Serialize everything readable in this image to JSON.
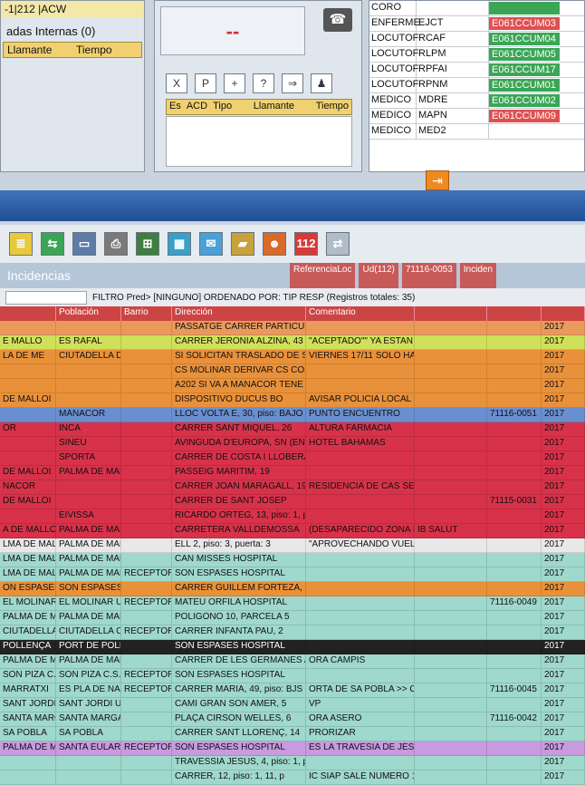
{
  "left_panel": {
    "ext": "-1|212   |ACW",
    "title": "adas Internas (0)",
    "columns": [
      "Llamante",
      "Tiempo"
    ]
  },
  "middle_panel": {
    "display": "--",
    "toolbar": [
      "X",
      "P",
      "+",
      "?",
      "⇒",
      "♟"
    ],
    "columns": [
      "Es",
      "ACD",
      "Tipo",
      "Llamante",
      "Tiempo"
    ]
  },
  "right_panel": {
    "rows": [
      {
        "role": "CORO",
        "code": "",
        "status": "",
        "color": "#3aa655"
      },
      {
        "role": "ENFERME",
        "code": "EJCT",
        "status": "E061CCUM03",
        "color": "#e05050"
      },
      {
        "role": "LOCUTOF",
        "code": "RCAF",
        "status": "E061CCUM04",
        "color": "#3aa655"
      },
      {
        "role": "LOCUTOF",
        "code": "RLPM",
        "status": "E061CCUM05",
        "color": "#3aa655"
      },
      {
        "role": "LOCUTOF",
        "code": "RPFAI",
        "status": "E061CCUM17",
        "color": "#3aa655"
      },
      {
        "role": "LOCUTOF",
        "code": "RPNM",
        "status": "E061CCUM01",
        "color": "#3aa655"
      },
      {
        "role": "MEDICO",
        "code": "MDRE",
        "status": "E061CCUM02",
        "color": "#3aa655"
      },
      {
        "role": "MEDICO",
        "code": "MAPN",
        "status": "E061CCUM09",
        "color": "#e05050"
      },
      {
        "role": "MEDICO",
        "code": "MED2",
        "status": "",
        "color": "#ffffff"
      }
    ]
  },
  "toolbar": {
    "icons": [
      {
        "name": "list-icon",
        "glyph": "≣",
        "bg": "#e7c93a"
      },
      {
        "name": "transfer-icon",
        "glyph": "⇆",
        "bg": "#3aa655"
      },
      {
        "name": "card-icon",
        "glyph": "▭",
        "bg": "#5d7da7"
      },
      {
        "name": "print-icon",
        "glyph": "⎙",
        "bg": "#7a7a7a"
      },
      {
        "name": "windows-icon",
        "glyph": "⊞",
        "bg": "#3e7e3e"
      },
      {
        "name": "gallery-icon",
        "glyph": "▦",
        "bg": "#3aa0c8"
      },
      {
        "name": "mail-icon",
        "glyph": "✉",
        "bg": "#4aa0d8"
      },
      {
        "name": "folder-icon",
        "glyph": "▰",
        "bg": "#c7a23a"
      },
      {
        "name": "people-icon",
        "glyph": "☻",
        "bg": "#d86a2a"
      },
      {
        "name": "emergency-112-icon",
        "glyph": "112",
        "bg": "#d83a3a"
      },
      {
        "name": "dispatch-icon",
        "glyph": "⇄",
        "bg": "#b0bcc8"
      }
    ],
    "exit_glyph": "⇥"
  },
  "grid": {
    "title": "Incidencias",
    "ref_labels": [
      "ReferenciaLoc",
      "Ud(112)",
      "Inciden"
    ],
    "ref_value": "71116-0053",
    "filter_text": "FILTRO Pred> [NINGUNO]  ORDENADO POR: TIP RESP (Registros totales: 35)",
    "headers": [
      "",
      "Población",
      "Barrio",
      "Dirección",
      "Comentario",
      "",
      "",
      ""
    ],
    "rows": [
      {
        "bg": "#e99a5a",
        "cells": [
          "",
          "",
          "",
          "PASSATGE CARRER PARTICULAR",
          "",
          "",
          "",
          "2017"
        ]
      },
      {
        "bg": "#cfe05a",
        "cells": [
          "E MALLO",
          "ES RAFAL",
          "",
          "CARRER JERONIA ALZINA, 43 (CI",
          "\"ACEPTADO\"\" YA ESTAN 1",
          "",
          "",
          "2017"
        ]
      },
      {
        "bg": "#e9913a",
        "cells": [
          "LA DE ME",
          "CIUTADELLA DE ME",
          "",
          "SI SOLICITAN TRASLADO DE SO",
          "VIERNES 17/11 SOLO HABF",
          "",
          "",
          "2017"
        ]
      },
      {
        "bg": "#e9913a",
        "cells": [
          "",
          "",
          "",
          "CS MOLINAR DERIVAR CS COLL",
          "",
          "",
          "",
          "2017"
        ]
      },
      {
        "bg": "#e9913a",
        "cells": [
          "",
          "",
          "",
          "A202 SI VA A MANACOR TENE",
          "",
          "",
          "",
          "2017"
        ]
      },
      {
        "bg": "#e9913a",
        "cells": [
          "DE MALLOI",
          "",
          "",
          "DISPOSITIVO DUCUS BO",
          "AVISAR POLICIA LOCAL SI",
          "",
          "",
          "2017"
        ]
      },
      {
        "bg": "#6a8fd0",
        "cells": [
          "",
          "MANACOR",
          "",
          "LLOC VOLTA E, 30, piso: BAJO",
          "PUNTO ENCUENTRO",
          "",
          "71116-0051",
          "2017"
        ]
      },
      {
        "bg": "#d8324a",
        "cells": [
          "OR",
          "INCA",
          "",
          "CARRER SANT MIQUEL, 26",
          "ALTURA FARMACIA",
          "",
          "",
          "2017"
        ]
      },
      {
        "bg": "#d8324a",
        "cells": [
          "",
          "SINEU",
          "",
          "AVINGUDA D'EUROPA, SN (EN",
          "HOTEL BAHAMAS",
          "",
          "",
          "2017"
        ]
      },
      {
        "bg": "#d8324a",
        "cells": [
          "",
          "SPORTA",
          "",
          "CARRER DE COSTA I LLOBERA",
          "",
          "",
          "",
          "2017"
        ]
      },
      {
        "bg": "#d8324a",
        "cells": [
          "DE MALLOI",
          "PALMA DE MALLOI",
          "",
          "PASSEIG MARITIM, 19",
          "",
          "",
          "",
          "2017"
        ]
      },
      {
        "bg": "#d8324a",
        "cells": [
          "NACOR",
          "",
          "",
          "CARRER JOAN MARAGALL, 19",
          "RESIDENCIA DE CAS SERRE",
          "",
          "",
          "2017"
        ]
      },
      {
        "bg": "#d8324a",
        "cells": [
          "DE MALLOI",
          "",
          "",
          "CARRER DE SANT JOSEP",
          "",
          "",
          "71115-0031",
          "2017"
        ]
      },
      {
        "bg": "#d8324a",
        "cells": [
          "",
          "EIVISSA",
          "",
          "RICARDO ORTEG, 13, piso: 1, pu",
          "",
          "",
          "",
          "2017"
        ]
      },
      {
        "bg": "#d8324a",
        "cells": [
          "A DE MALLOI",
          "PALMA DE MALLOI",
          "",
          "CARRETERA VALLDEMOSSA",
          "(DESAPARECIDO ZONA BU",
          "IB SALUT",
          "",
          "2017"
        ]
      },
      {
        "bg": "#e8e8e8",
        "cells": [
          "LMA DE MALLOI",
          "PALMA DE MALLOI",
          "",
          "ELL 2, piso: 3, puerta: 3",
          "\"APROVECHANDO VUELO\"",
          "",
          "",
          "2017"
        ]
      },
      {
        "bg": "#9fd8cc",
        "cells": [
          "LMA DE MALLOI",
          "PALMA DE MALLOI",
          "",
          "CAN MISSES HOSPITAL",
          "",
          "",
          "",
          "2017"
        ]
      },
      {
        "bg": "#9fd8cc",
        "cells": [
          "LMA DE MALLOI",
          "PALMA DE MALLOI",
          "RECEPTOR",
          "SON ESPASES HOSPITAL",
          "",
          "",
          "",
          "2017"
        ]
      },
      {
        "bg": "#e9913a",
        "cells": [
          "ON ESPASES HO",
          "SON ESPASES HO",
          "",
          "CARRER GUILLEM FORTEZA, 8",
          "",
          "",
          "",
          "2017"
        ]
      },
      {
        "bg": "#9fd8cc",
        "cells": [
          "EL MOLINAR U.B.S",
          "EL MOLINAR U.B.S",
          "RECEPTOR",
          "MATEU ORFILA HOSPITAL",
          "",
          "",
          "71116-0049",
          "2017"
        ]
      },
      {
        "bg": "#9fd8cc",
        "cells": [
          "PALMA DE MALLOI",
          "PALMA DE MALLOI",
          "",
          "POLIGONO 10, PARCELA 5",
          "",
          "",
          "",
          "2017"
        ]
      },
      {
        "bg": "#9fd8cc",
        "cells": [
          "CIUTADELLA C.S.",
          "CIUTADELLA C.S.",
          "RECEPTOR",
          "CARRER INFANTA PAU, 2",
          "",
          "",
          "",
          "2017"
        ]
      },
      {
        "bg": "#222222",
        "cells": [
          "POLLENÇA",
          "PORT DE POLLEN",
          "",
          "SON ESPASES HOSPITAL",
          "",
          "",
          "",
          "2017"
        ]
      },
      {
        "bg": "#9fd8cc",
        "cells": [
          "PALMA DE MALLOI",
          "PALMA DE MALLOI",
          "",
          "CARRER DE LES GERMANES AGI",
          "ORA CAMPIS",
          "",
          "",
          "2017"
        ]
      },
      {
        "bg": "#9fd8cc",
        "cells": [
          "SON PIZA C.S.",
          "SON PIZA C.S.",
          "RECEPTOR",
          "SON ESPASES HOSPITAL",
          "",
          "",
          "",
          "2017"
        ]
      },
      {
        "bg": "#9fd8cc",
        "cells": [
          "MARRATXI",
          "ES PLA DE NA TES",
          "RECEPTOR",
          "CARRER MARIA, 49, piso: BJS",
          "ORTA DE SA POBLA >> CAI",
          "",
          "71116-0045",
          "2017"
        ]
      },
      {
        "bg": "#9fd8cc",
        "cells": [
          "SANT JORDI U.B.S",
          "SANT JORDI U.B.S",
          "",
          "CAMI GRAN SON AMER, 5",
          "VP",
          "",
          "",
          "2017"
        ]
      },
      {
        "bg": "#9fd8cc",
        "cells": [
          "SANTA MARGALI",
          "SANTA MARGALID",
          "",
          "PLAÇA CIRSON WELLES, 6",
          "ORA ASERO",
          "",
          "71116-0042",
          "2017"
        ]
      },
      {
        "bg": "#9fd8cc",
        "cells": [
          "SA POBLA",
          "SA POBLA",
          "",
          "CARRER SANT LLORENÇ, 14",
          "PRORIZAR",
          "",
          "",
          "2017"
        ]
      },
      {
        "bg": "#c89ae0",
        "cells": [
          "PALMA DE MALLOI",
          "SANTA EULARIA D",
          "RECEPTOR",
          "SON ESPASES HOSPITAL",
          "ES LA TRAVESIA DE JESUS",
          "",
          "",
          "2017"
        ]
      },
      {
        "bg": "#9fd8cc",
        "cells": [
          "",
          "",
          "",
          "TRAVESSIA JESUS, 4, piso: 1, pu",
          "",
          "",
          "",
          "2017"
        ]
      },
      {
        "bg": "#9fd8cc",
        "cells": [
          "",
          "",
          "",
          "CARRER, 12, piso: 1, 11, p",
          "IC SIAP SALE NUMERO 1",
          "",
          "",
          "2017"
        ]
      }
    ]
  }
}
